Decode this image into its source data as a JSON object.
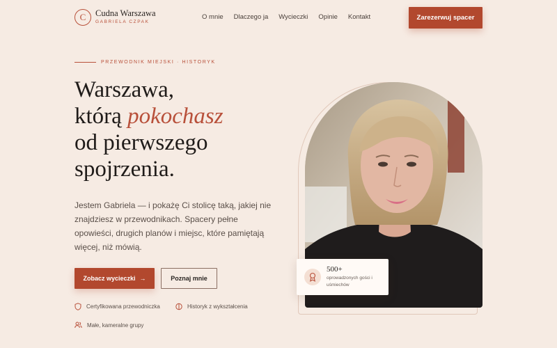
{
  "header": {
    "logo_mark": "C",
    "logo_name": "Cudna Warszawa",
    "logo_sub": "GABRIELA CZPAK",
    "nav": [
      "O mnie",
      "Dlaczego ja",
      "Wycieczki",
      "Opinie",
      "Kontakt"
    ],
    "cta": "Zarezerwuj spacer"
  },
  "hero": {
    "eyebrow": "PRZEWODNIK MIEJSKI · HISTORYK",
    "headline_line1": "Warszawa,",
    "headline_line2_plain": "którą ",
    "headline_line2_accent": "pokochasz",
    "headline_line3": "od pierwszego",
    "headline_line4": "spojrzenia.",
    "intro": "Jestem Gabriela — i pokażę Ci stolicę taką, jakiej nie znajdziesz w przewodnikach. Spacery pełne opowieści, drugich planów i miejsc, które pamiętają więcej, niż mówią.",
    "primary_button": "Zobacz wycieczki",
    "primary_arrow": "→",
    "secondary_button": "Poznaj mnie",
    "features": [
      {
        "label": "Certyfikowana przewodniczka",
        "icon": "shield-icon"
      },
      {
        "label": "Historyk z wykształcenia",
        "icon": "book-icon"
      },
      {
        "label": "Małe, kameralne grupy",
        "icon": "users-icon"
      }
    ]
  },
  "badge": {
    "number": "500+",
    "description": "oprowadzonych gości i uśmiechów",
    "icon": "award-icon"
  },
  "colors": {
    "background": "#f6ebe3",
    "accent": "#b2482e",
    "text": "#2a2522"
  }
}
